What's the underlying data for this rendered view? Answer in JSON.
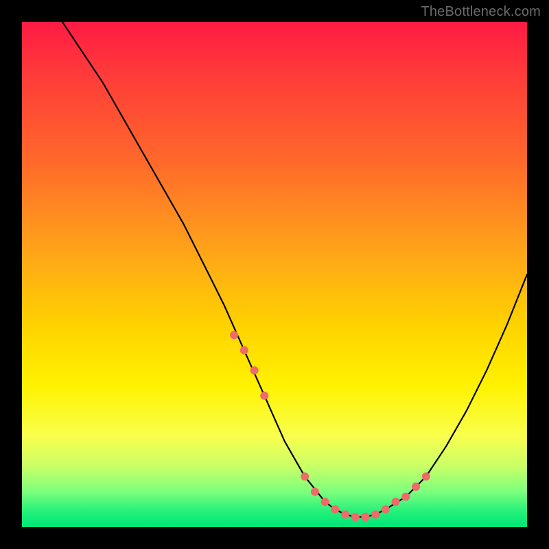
{
  "watermark": "TheBottleneck.com",
  "chart_data": {
    "type": "line",
    "title": "",
    "xlabel": "",
    "ylabel": "",
    "xlim": [
      0,
      100
    ],
    "ylim": [
      0,
      100
    ],
    "x": [
      8,
      12,
      16,
      20,
      24,
      28,
      32,
      36,
      40,
      44,
      48,
      52,
      56,
      60,
      62,
      64,
      66,
      68,
      70,
      72,
      76,
      80,
      84,
      88,
      92,
      96,
      100
    ],
    "values": [
      100,
      94,
      88,
      81,
      74,
      67,
      60,
      52,
      44,
      35,
      26,
      17,
      10,
      5,
      3.5,
      2.5,
      2,
      2,
      2.5,
      3.5,
      6,
      10,
      16,
      23,
      31,
      40,
      50
    ],
    "markers": {
      "x": [
        42,
        44,
        46,
        48,
        56,
        58,
        60,
        62,
        64,
        66,
        68,
        70,
        72,
        74,
        76,
        78,
        80
      ],
      "values": [
        38,
        35,
        31,
        26,
        10,
        7,
        5,
        3.5,
        2.5,
        2,
        2,
        2.5,
        3.5,
        5,
        6,
        8,
        10
      ],
      "color": "#ef6a6a"
    },
    "curve_color": "#000000",
    "background": "gradient-red-yellow-green"
  }
}
